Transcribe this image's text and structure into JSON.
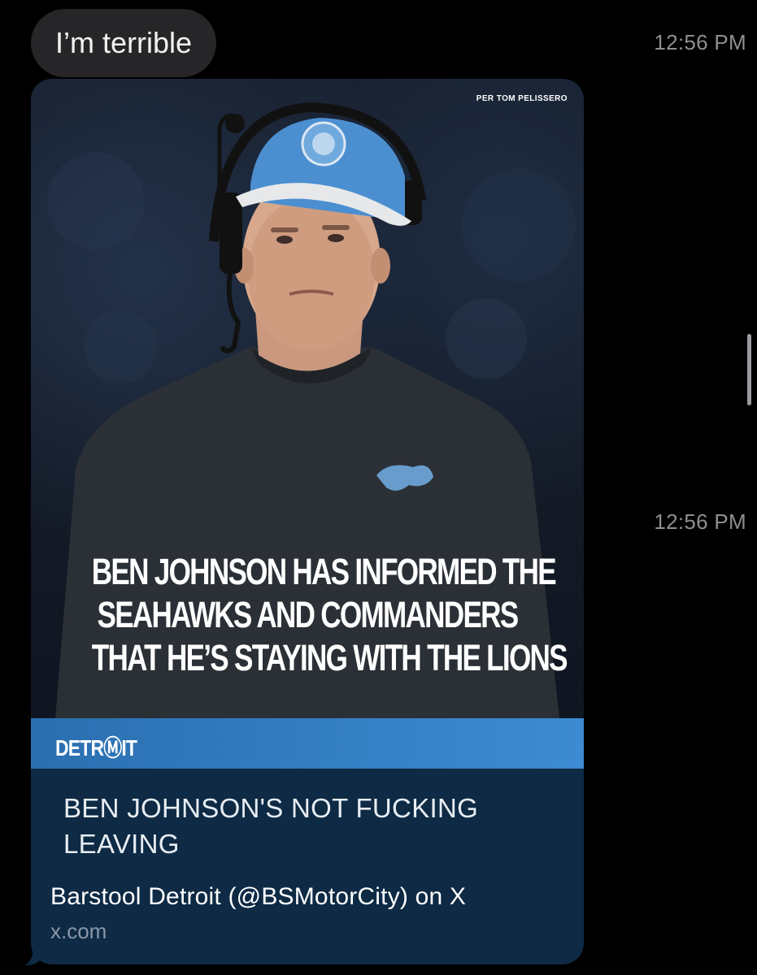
{
  "messages": {
    "text_bubble": "I’m terrible",
    "timestamp_1": "12:56 PM",
    "timestamp_2": "12:56 PM"
  },
  "link_preview": {
    "image_credit": "PER TOM PELISSERO",
    "headline_lines": [
      "BEN JOHNSON HAS INFORMED THE",
      "SEAHAWKS AND COMMANDERS",
      "THAT HE’S STAYING WITH THE LIONS"
    ],
    "brand": "DETRⓂIT",
    "caption": "BEN JOHNSON'S NOT FUCKING LEAVING",
    "site_title": "Barstool Detroit (@BSMotorCity) on X",
    "domain": "x.com"
  },
  "colors": {
    "background": "#000000",
    "bubble_gray": "#262628",
    "card_navy": "#0e2a44",
    "brand_blue": "#3d8bd2",
    "cap_blue": "#4b8fd0",
    "timestamp_gray": "#8e8e93"
  },
  "icons": {
    "brand_mark": "barstool-stool-icon",
    "cap_logo": "lions-cap-logo-icon",
    "shirt_logo": "lion-logo-icon"
  }
}
